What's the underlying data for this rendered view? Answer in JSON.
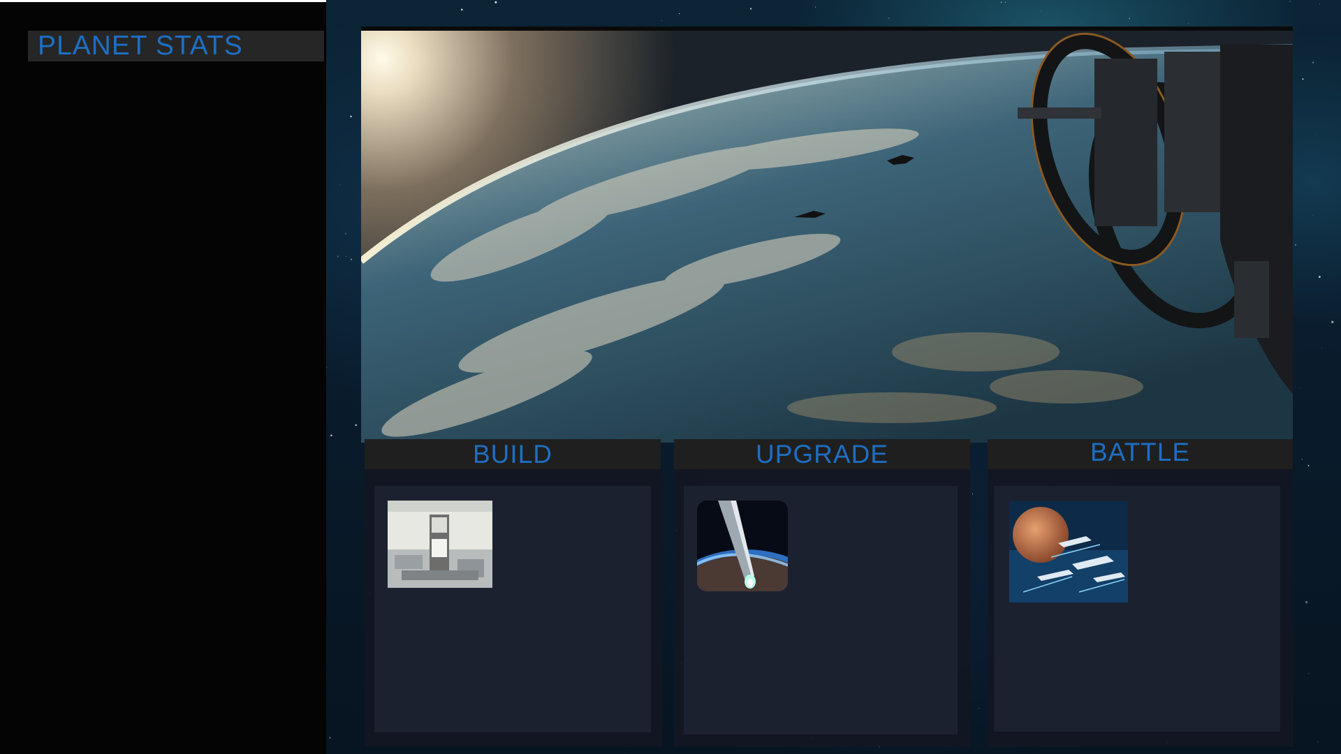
{
  "sidebar": {
    "title": "PLANET STATS"
  },
  "hero": {
    "image": "planet-orbit-space-station-image"
  },
  "panels": [
    {
      "label": "BUILD",
      "thumbnail": "spacecraft-assembly-facility-image"
    },
    {
      "label": "UPGRADE",
      "thumbnail": "ship-launch-over-planet-image"
    },
    {
      "label": "BATTLE",
      "thumbnail": "fleet-battle-near-red-planet-image"
    }
  ],
  "colors": {
    "accent_text": "#1d6fc4",
    "sidebar_bg": "#040404",
    "header_bg": "#262626",
    "tab_bg": "#1f1f1f",
    "panel_bg": "#1c2130"
  }
}
